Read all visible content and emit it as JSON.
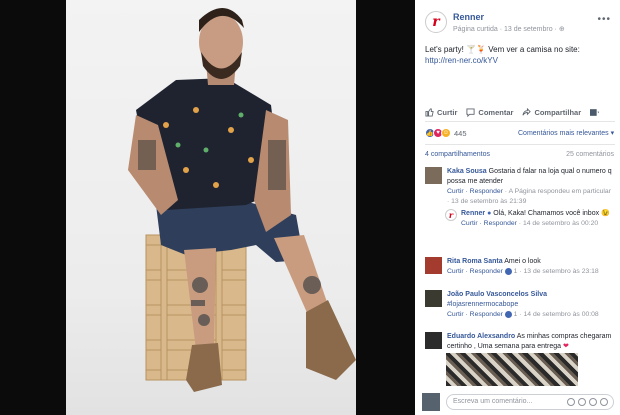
{
  "post": {
    "page_name": "Renner",
    "logo_letter": "r",
    "meta": "Página curtida · 13 de setembro · ",
    "text": "Let's party! 🍸🍹 Vem ver a camisa no site:",
    "link": "http://ren-ner.co/kYV"
  },
  "actions": {
    "like": "Curtir",
    "comment": "Comentar",
    "share": "Compartilhar"
  },
  "reactions": {
    "count": "445",
    "relevant": "Comentários mais relevantes ▾"
  },
  "stats": {
    "shares": "4 compartilhamentos",
    "comments": "25 comentários"
  },
  "comments": [
    {
      "name": "Kaka Sousa",
      "text": "Gostaria d falar na loja qual o numero q possa me atender",
      "meta_links": "Curtir · Responder",
      "meta": " · A Página respondeu em particular · 13 de setembro às 21:39"
    },
    {
      "name": "Renner",
      "text": "Olá, Kaka! Chamamos você inbox 😉",
      "meta_links": "Curtir · Responder",
      "meta": " · 14 de setembro às 00:20"
    },
    {
      "name": "Rita Roma Santa",
      "text": "Amei o look",
      "meta_links": "Curtir · Responder",
      "meta": " 1 · 13 de setembro às 23:18"
    },
    {
      "name": "João Paulo Vasconcelos Silva",
      "text": "#lojasrennermocabope",
      "meta_links": "Curtir · Responder",
      "meta": " 1 · 14 de setembro às 00:08"
    },
    {
      "name": "Eduardo Alexsandro",
      "text": "As minhas compras chegaram certinho , Uma semana para entrega",
      "heart": "❤"
    }
  ],
  "composer": {
    "placeholder": "Escreva um comentário..."
  },
  "colors": {
    "link": "#365899",
    "brand_red": "#d6001c",
    "like_blue": "#4267b2"
  }
}
